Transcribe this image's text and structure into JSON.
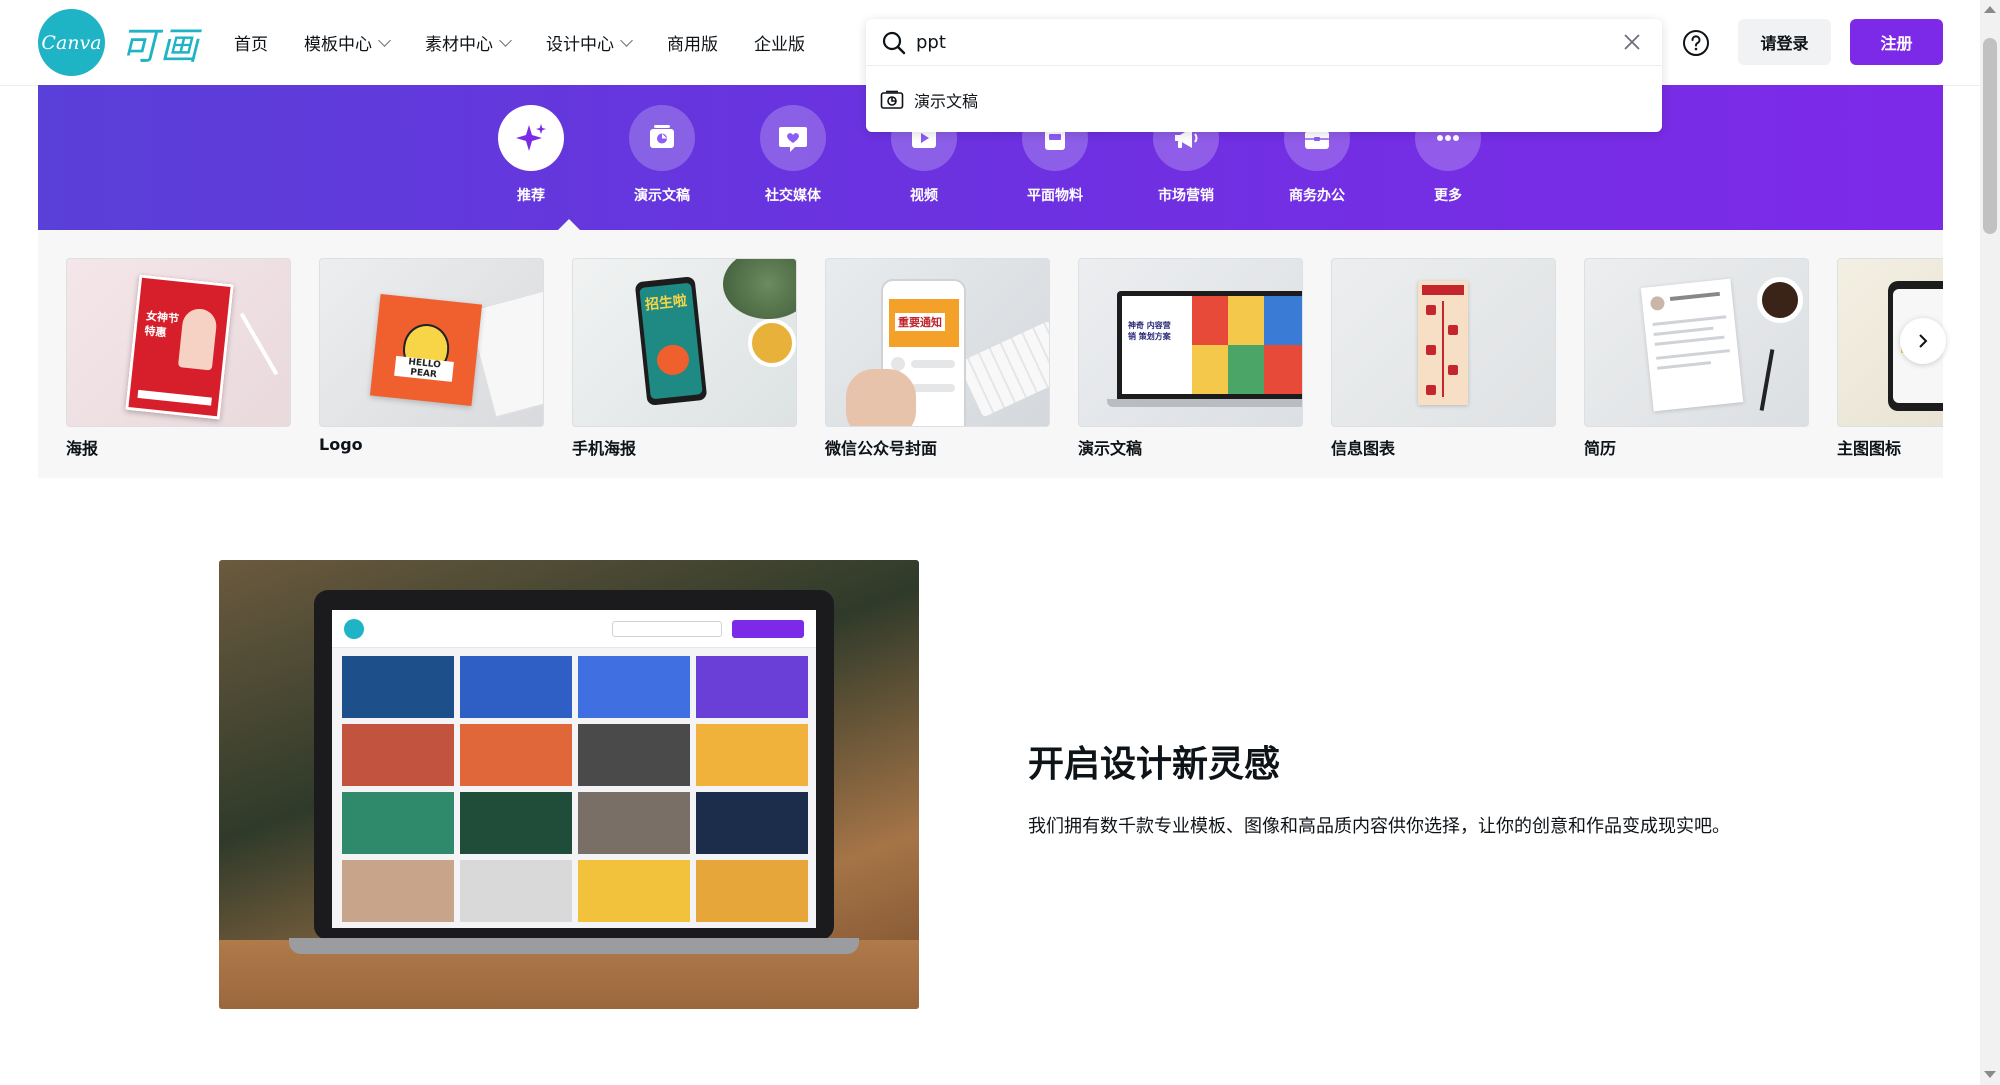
{
  "brand": {
    "logo_text": "Canva",
    "cn_name": "可画",
    "accent": "#7d2ae8",
    "teal": "#1fb3c6"
  },
  "nav": [
    {
      "label": "首页",
      "dropdown": false
    },
    {
      "label": "模板中心",
      "dropdown": true
    },
    {
      "label": "素材中心",
      "dropdown": true
    },
    {
      "label": "设计中心",
      "dropdown": true
    },
    {
      "label": "商用版",
      "dropdown": false
    },
    {
      "label": "企业版",
      "dropdown": false
    }
  ],
  "search": {
    "value": "ppt",
    "suggestion": "演示文稿"
  },
  "auth": {
    "login": "请登录",
    "register": "注册"
  },
  "categories": [
    {
      "label": "推荐",
      "icon": "sparkle-icon",
      "active": true
    },
    {
      "label": "演示文稿",
      "icon": "presentation-icon"
    },
    {
      "label": "社交媒体",
      "icon": "heart-chat-icon"
    },
    {
      "label": "视频",
      "icon": "video-icon"
    },
    {
      "label": "平面物料",
      "icon": "print-icon"
    },
    {
      "label": "市场营销",
      "icon": "megaphone-icon"
    },
    {
      "label": "商务办公",
      "icon": "briefcase-icon"
    },
    {
      "label": "更多",
      "icon": "more-icon"
    }
  ],
  "templates": [
    {
      "label": "海报"
    },
    {
      "label": "Logo"
    },
    {
      "label": "手机海报"
    },
    {
      "label": "微信公众号封面"
    },
    {
      "label": "演示文稿"
    },
    {
      "label": "信息图表"
    },
    {
      "label": "简历"
    },
    {
      "label": "主图图标"
    }
  ],
  "template_art": {
    "poster_lines": [
      "女神节",
      "特惠"
    ],
    "logo_text": "HELLO PEAR",
    "mobile_text": "招生啦",
    "wechat_text": "重要通知",
    "ppt_text": "神奇 内容营销 策划方案"
  },
  "feature": {
    "title": "开启设计新灵感",
    "text": "我们拥有数千款专业模板、图像和高品质内容供你选择，让你的创意和作品变成现实吧。"
  }
}
